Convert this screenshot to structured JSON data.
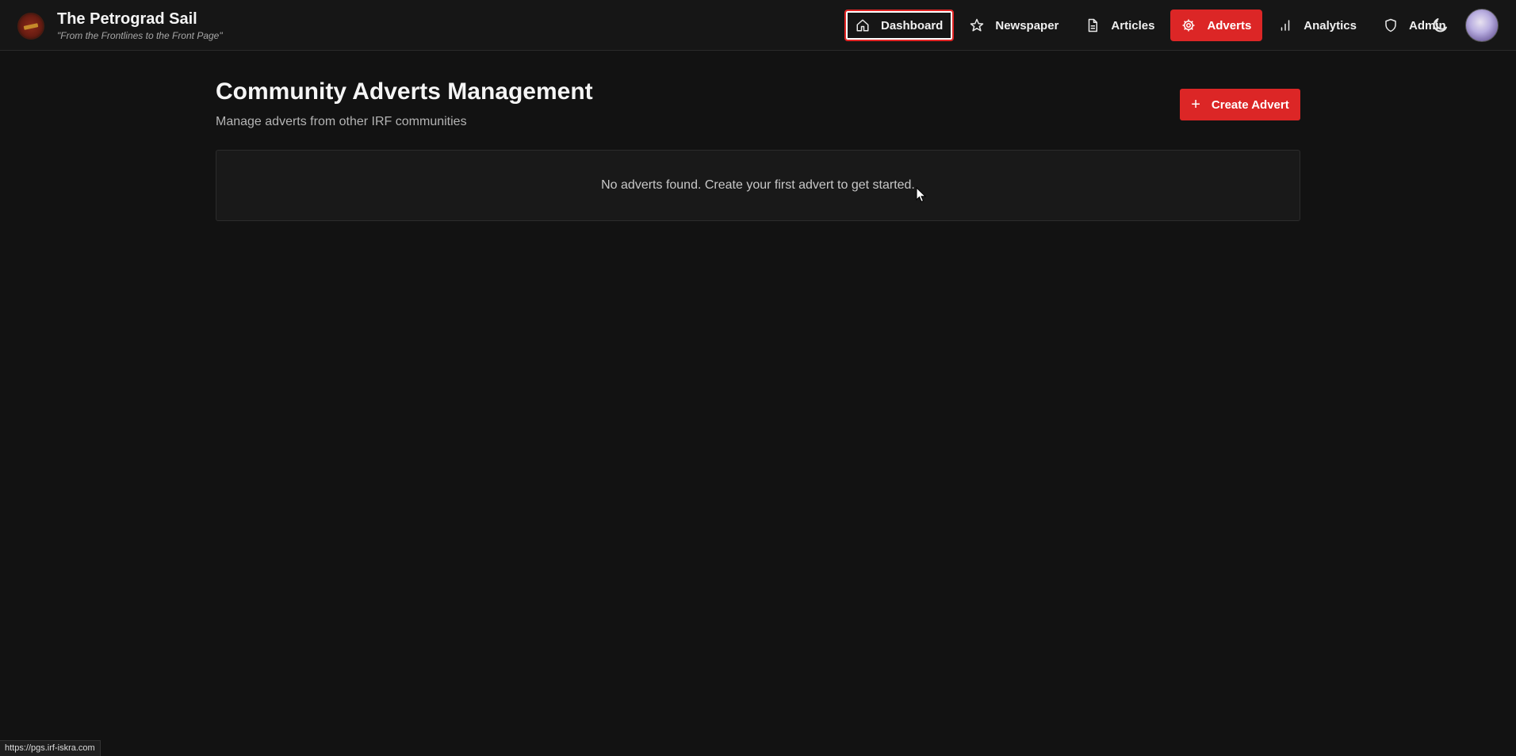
{
  "brand": {
    "title": "The Petrograd Sail",
    "tagline": "\"From the Frontlines to the Front Page\""
  },
  "nav": {
    "items": [
      {
        "label": "Dashboard",
        "icon": "home-icon",
        "state": "focused"
      },
      {
        "label": "Newspaper",
        "icon": "star-icon",
        "state": "normal"
      },
      {
        "label": "Articles",
        "icon": "document-icon",
        "state": "normal"
      },
      {
        "label": "Adverts",
        "icon": "gear-icon",
        "state": "active"
      },
      {
        "label": "Analytics",
        "icon": "bar-chart-icon",
        "state": "normal"
      },
      {
        "label": "Admin",
        "icon": "shield-icon",
        "state": "normal"
      }
    ],
    "theme_toggle_icon": "moon-icon"
  },
  "page": {
    "title": "Community Adverts Management",
    "subtitle": "Manage adverts from other IRF communities",
    "create_button_label": "Create Advert",
    "empty_message": "No adverts found. Create your first advert to get started."
  },
  "status_bar": {
    "url": "https://pgs.irf-iskra.com"
  },
  "colors": {
    "accent": "#dc2626",
    "background": "#121212",
    "card": "#191919"
  }
}
